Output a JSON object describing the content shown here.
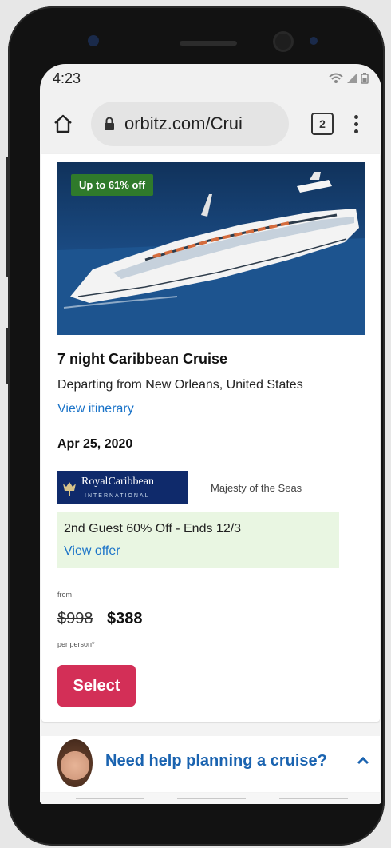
{
  "status_bar": {
    "time": "4:23"
  },
  "browser": {
    "url": "orbitz.com/Crui",
    "tab_count": "2"
  },
  "listing": {
    "deal_badge": "Up to 61% off",
    "title": "7 night Caribbean Cruise",
    "departing": "Departing from New Orleans, United States",
    "view_itinerary": "View itinerary",
    "sail_date": "Apr 25, 2020",
    "cruise_line_logo_text": "RoyalCaribbean",
    "cruise_line_logo_subtext": "INTERNATIONAL",
    "ship_name": "Majesty of the Seas",
    "offer_text": "2nd Guest 60% Off - Ends 12/3",
    "view_offer": "View offer",
    "from_label": "from",
    "old_price": "$998",
    "new_price": "$388",
    "per_person": "per person*",
    "select_label": "Select"
  },
  "help": {
    "text": "Need help planning a cruise?"
  },
  "colors": {
    "link": "#1a73c8",
    "select_button": "#d32f57",
    "deal_badge": "#2f7a2b",
    "offer_background": "#e9f6e2",
    "help_text": "#1a63b0"
  }
}
